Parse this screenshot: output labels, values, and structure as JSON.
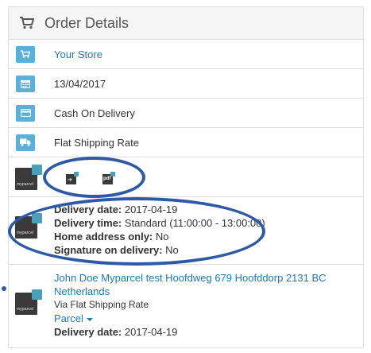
{
  "panel": {
    "title": "Order Details",
    "title_icon": "cart-icon"
  },
  "rows": {
    "store": {
      "icon": "cart-icon",
      "text": "Your Store"
    },
    "date": {
      "icon": "calendar-icon",
      "text": "13/04/2017"
    },
    "payment": {
      "icon": "credit-card-icon",
      "text": "Cash On Delivery"
    },
    "shipping": {
      "icon": "truck-icon",
      "text": "Flat Shipping Rate"
    }
  },
  "myparcel": {
    "logo_text": "myparcel",
    "action_icons": [
      "export-icon",
      "pdf-icon"
    ],
    "pdf_label": "pdf"
  },
  "delivery": {
    "date_label": "Delivery date:",
    "date_value": "2017-04-19",
    "time_label": "Delivery time:",
    "time_value": "Standard (11:00:00 - 13:00:00)",
    "home_label": "Home address only:",
    "home_value": "No",
    "signature_label": "Signature on delivery:",
    "signature_value": "No"
  },
  "address": {
    "line1": "John Doe Myparcel test Hoofdweg 679 Hoofddorp 2131 BC",
    "line2": "Netherlands",
    "via": "Via Flat Shipping Rate",
    "package_type": "Parcel",
    "date_label": "Delivery date:",
    "date_value": "2017-04-19"
  },
  "colors": {
    "accent": "#5ab0dc",
    "link": "#1e78b8",
    "annotation": "#2d5aa6",
    "logo_dark": "#3a3a3a",
    "logo_accent": "#4aa0b8"
  }
}
